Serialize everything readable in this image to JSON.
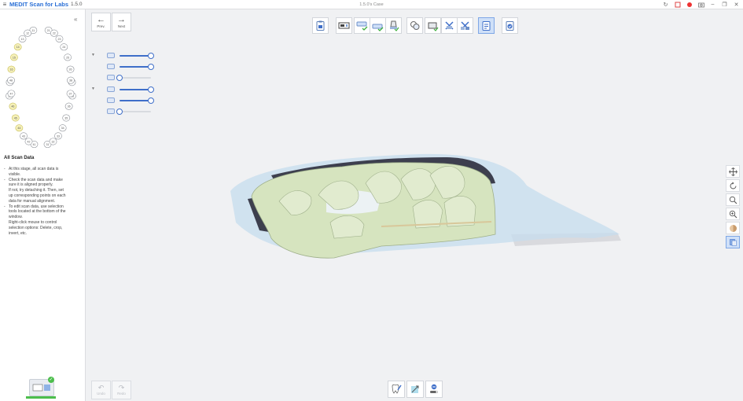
{
  "titlebar": {
    "app_name": "MEDIT Scan for Labs",
    "version": "1.5.0",
    "case_name": "1.5.0's Case",
    "menu_icon": "hamburger-icon",
    "right_icons": [
      "history-icon",
      "crop-screen-icon",
      "record-icon",
      "screenshot-icon",
      "minimize-icon",
      "restore-icon",
      "close-icon"
    ]
  },
  "nav": {
    "prev_label": "Prev.",
    "next_label": "Next"
  },
  "sidebar": {
    "collapse_glyph": "«",
    "info_title": "All Scan Data",
    "info_lines": [
      {
        "bullet": true,
        "text": "At this stage, all scan data is"
      },
      {
        "bullet": false,
        "text": "visible."
      },
      {
        "bullet": true,
        "text": "Check the scan data and make"
      },
      {
        "bullet": false,
        "text": "sure it is aligned properly."
      },
      {
        "bullet": false,
        "text": "If not, try detaching it. Then, set"
      },
      {
        "bullet": false,
        "text": "up corresponding points on each"
      },
      {
        "bullet": false,
        "text": "data for manual alignment."
      },
      {
        "bullet": true,
        "text": "To edit scan data, use selection"
      },
      {
        "bullet": false,
        "text": "tools located at the bottom of the"
      },
      {
        "bullet": false,
        "text": "window."
      },
      {
        "bullet": false,
        "text": "Right-click mouse to control"
      },
      {
        "bullet": false,
        "text": "selection options: Delete, crop,"
      },
      {
        "bullet": false,
        "text": "invert, etc."
      }
    ],
    "upper_teeth": [
      "11",
      "12",
      "13",
      "14",
      "15",
      "16",
      "17",
      "18",
      "21",
      "22",
      "23",
      "24",
      "25",
      "26",
      "27",
      "28"
    ],
    "lower_teeth": [
      "31",
      "32",
      "33",
      "34",
      "35",
      "36",
      "37",
      "38",
      "41",
      "42",
      "43",
      "44",
      "45",
      "46",
      "47",
      "48"
    ]
  },
  "sliders": [
    {
      "group": "upper",
      "level": 1.0
    },
    {
      "group": "upper",
      "level": 1.0
    },
    {
      "group": "upper",
      "level": 0.0
    },
    {
      "group": "lower",
      "level": 1.0
    },
    {
      "group": "lower",
      "level": 1.0
    },
    {
      "group": "lower",
      "level": 0.0
    }
  ],
  "undo_redo": {
    "undo_label": "Undo",
    "redo_label": "Redo"
  },
  "colors": {
    "accent": "#2a6fd6",
    "active_tool": "#cfe0f8",
    "model_green": "#d6e4bf",
    "model_blue": "#c5dcee",
    "selected_tooth": "#f5f0b8",
    "success": "#4cbe4c"
  }
}
